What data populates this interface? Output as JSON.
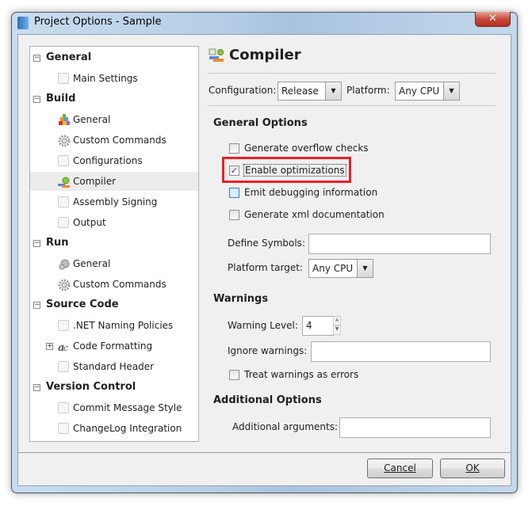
{
  "window": {
    "title": "Project Options - Sample",
    "close_glyph": "✕"
  },
  "tree": {
    "items": [
      {
        "label": "General",
        "type": "header",
        "expander": "−"
      },
      {
        "label": "Main Settings",
        "type": "child",
        "icon": "blank-icon"
      },
      {
        "label": "Build",
        "type": "header",
        "expander": "−"
      },
      {
        "label": "General",
        "type": "child",
        "icon": "build-blocks-icon"
      },
      {
        "label": "Custom Commands",
        "type": "child",
        "icon": "gear-icon"
      },
      {
        "label": "Configurations",
        "type": "child",
        "icon": "blank-icon"
      },
      {
        "label": "Compiler",
        "type": "child",
        "icon": "compiler-icon",
        "selected": true
      },
      {
        "label": "Assembly Signing",
        "type": "child",
        "icon": "blank-icon"
      },
      {
        "label": "Output",
        "type": "child",
        "icon": "blank-icon"
      },
      {
        "label": "Run",
        "type": "header",
        "expander": "−"
      },
      {
        "label": "General",
        "type": "child",
        "icon": "run-gear-icon"
      },
      {
        "label": "Custom Commands",
        "type": "child",
        "icon": "gear-icon"
      },
      {
        "label": "Source Code",
        "type": "header",
        "expander": "−"
      },
      {
        "label": ".NET Naming Policies",
        "type": "child",
        "icon": "blank-icon"
      },
      {
        "label": "Code Formatting",
        "type": "child",
        "icon": "code-format-icon",
        "expander": "+"
      },
      {
        "label": "Standard Header",
        "type": "child",
        "icon": "blank-icon"
      },
      {
        "label": "Version Control",
        "type": "header",
        "expander": "−"
      },
      {
        "label": "Commit Message Style",
        "type": "child",
        "icon": "blank-icon"
      },
      {
        "label": "ChangeLog Integration",
        "type": "child",
        "icon": "blank-icon"
      }
    ]
  },
  "panel": {
    "title": "Compiler",
    "configuration_label": "Configuration:",
    "configuration_value": "Release",
    "platform_label": "Platform:",
    "platform_value": "Any CPU",
    "general_options": "General Options",
    "checks": [
      {
        "label": "Generate overflow checks",
        "checked": false
      },
      {
        "label": "Enable optimizations",
        "checked": true,
        "highlighted": true
      },
      {
        "label": "Emit debugging information",
        "checked": false
      },
      {
        "label": "Generate xml documentation",
        "checked": false
      }
    ],
    "define_symbols_label": "Define Symbols:",
    "define_symbols_value": "",
    "platform_target_label": "Platform target:",
    "platform_target_value": "Any CPU",
    "warnings": "Warnings",
    "warning_level_label": "Warning Level:",
    "warning_level_value": "4",
    "ignore_warnings_label": "Ignore warnings:",
    "ignore_warnings_value": "",
    "treat_warnings_label": "Treat warnings as errors",
    "additional_options": "Additional Options",
    "additional_arguments_label": "Additional arguments:",
    "additional_arguments_value": ""
  },
  "buttons": {
    "cancel": "Cancel",
    "ok": "OK"
  },
  "colors": {
    "highlight": "#e8202a",
    "selection": "#ececec"
  }
}
